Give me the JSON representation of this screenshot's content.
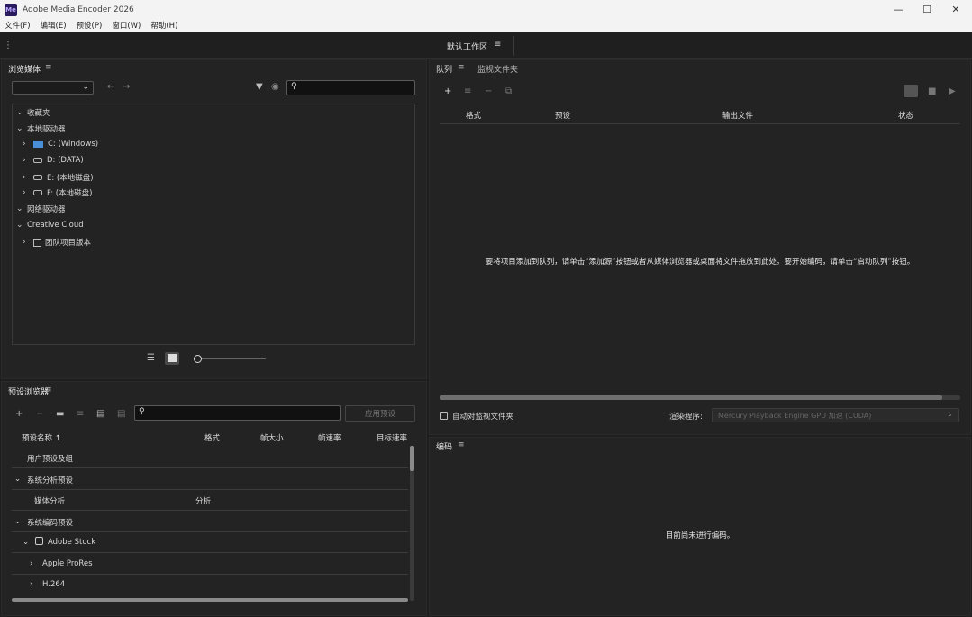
{
  "window": {
    "app_icon": "Me",
    "title": "Adobe Media Encoder 2026",
    "minimize": "—",
    "maximize": "☐",
    "close": "✕"
  },
  "menu": [
    "文件(F)",
    "编辑(E)",
    "预设(P)",
    "窗口(W)",
    "帮助(H)"
  ],
  "workspace": {
    "name": "默认工作区",
    "menu": "≡"
  },
  "media_browser": {
    "title": "浏览媒体",
    "menu": "≡",
    "location_value": "",
    "search_placeholder": "",
    "tree": [
      {
        "label": "收藏夹",
        "toggle": "⌄"
      },
      {
        "label": "本地驱动器",
        "toggle": "⌄"
      },
      {
        "label": "C: (Windows)",
        "toggle": "›"
      },
      {
        "label": "D: (DATA)",
        "toggle": "›"
      },
      {
        "label": "E: (本地磁盘)",
        "toggle": "›"
      },
      {
        "label": "F: (本地磁盘)",
        "toggle": "›"
      },
      {
        "label": "网络驱动器",
        "toggle": "⌄"
      },
      {
        "label": "Creative Cloud",
        "toggle": "⌄"
      },
      {
        "label": "团队项目版本",
        "toggle": "›"
      }
    ]
  },
  "preset_browser": {
    "title": "预设浏览器",
    "menu": "≡",
    "search_placeholder": "",
    "apply_label": "应用预设",
    "columns": [
      "预设名称 ↑",
      "格式",
      "帧大小",
      "帧速率",
      "目标速率"
    ],
    "rows": [
      {
        "name": "用户预设及组",
        "format": "",
        "toggle": ""
      },
      {
        "name": "系统分析预设",
        "format": "",
        "toggle": "⌄"
      },
      {
        "name": "媒体分析",
        "format": "分析",
        "toggle": ""
      },
      {
        "name": "系统编码预设",
        "format": "",
        "toggle": "⌄"
      },
      {
        "name": "Adobe Stock",
        "format": "",
        "toggle": "⌄"
      },
      {
        "name": "Apple ProRes",
        "format": "",
        "toggle": "›"
      },
      {
        "name": "H.264",
        "format": "",
        "toggle": "›"
      }
    ]
  },
  "queue": {
    "tab_queue": "队列",
    "tab_menu": "≡",
    "tab_watch": "监视文件夹",
    "columns": [
      "格式",
      "预设",
      "输出文件",
      "状态"
    ],
    "empty_message": "要将项目添加到队列，请单击“添加源”按钮或者从媒体浏览器或桌面将文件拖放到此处。要开始编码，请单击“启动队列”按钮。",
    "auto_encode_label": "自动对监视文件夹",
    "renderer_label": "渲染程序:",
    "renderer_value": "Mercury Playback Engine GPU 加速 (CUDA)"
  },
  "encoding": {
    "title": "编码",
    "menu": "≡",
    "empty_message": "目前尚未进行编码。"
  }
}
